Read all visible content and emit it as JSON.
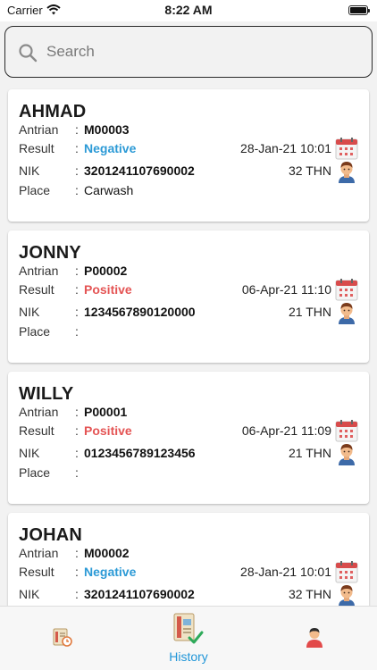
{
  "status_bar": {
    "carrier": "Carrier",
    "time": "8:22 AM"
  },
  "search": {
    "placeholder": "Search",
    "value": ""
  },
  "labels": {
    "antrian": "Antrian",
    "result": "Result",
    "nik": "NIK",
    "place": "Place",
    "colon": ":"
  },
  "colors": {
    "negative": "#2c9ad6",
    "positive": "#e45454",
    "tab_active": "#2196d8"
  },
  "records": [
    {
      "name": "AHMAD",
      "antrian": "M00003",
      "result": "Negative",
      "date": "28-Jan-21 10:01",
      "nik": "3201241107690002",
      "age": "32 THN",
      "place": "Carwash"
    },
    {
      "name": "JONNY",
      "antrian": "P00002",
      "result": "Positive",
      "date": "06-Apr-21 11:10",
      "nik": "1234567890120000",
      "age": "21 THN",
      "place": ""
    },
    {
      "name": "WILLY",
      "antrian": "P00001",
      "result": "Positive",
      "date": "06-Apr-21 11:09",
      "nik": "0123456789123456",
      "age": "21 THN",
      "place": ""
    },
    {
      "name": "JOHAN",
      "antrian": "M00002",
      "result": "Negative",
      "date": "28-Jan-21 10:01",
      "nik": "3201241107690002",
      "age": "32 THN",
      "place": ""
    }
  ],
  "tabs": [
    {
      "label": "",
      "icon": "queue-history-icon",
      "active": false
    },
    {
      "label": "History",
      "icon": "history-check-icon",
      "active": true
    },
    {
      "label": "",
      "icon": "profile-icon",
      "active": false
    }
  ]
}
